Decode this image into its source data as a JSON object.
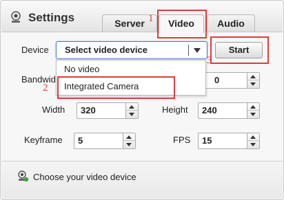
{
  "header": {
    "title": "Settings",
    "tabs": [
      {
        "label": "Server",
        "active": false
      },
      {
        "label": "Video",
        "active": true
      },
      {
        "label": "Audio",
        "active": false
      }
    ]
  },
  "annotations": [
    "1",
    "2",
    "3"
  ],
  "form": {
    "device_label": "Device",
    "device_select_value": "Select video device",
    "start_label": "Start",
    "dropdown_options": [
      "No video",
      "Integrated Camera"
    ],
    "bandwidth_label": "Bandwid",
    "bandwidth_value": "0",
    "width_label": "Width",
    "width_value": "320",
    "height_label": "Height",
    "height_value": "240",
    "keyframe_label": "Keyframe",
    "keyframe_value": "5",
    "fps_label": "FPS",
    "fps_value": "15"
  },
  "footer": {
    "message": "Choose your video device"
  },
  "colors": {
    "annotation": "#e03b3b",
    "select_border": "#4b7dc8"
  },
  "icons": {
    "header": "webcam-icon",
    "footer": "webcam-status-icon"
  }
}
